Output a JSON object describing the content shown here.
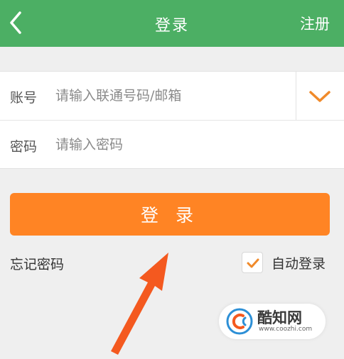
{
  "header": {
    "title": "登录",
    "register_label": "注册",
    "background": "#4caf64"
  },
  "form": {
    "account": {
      "label": "账号",
      "placeholder": "请输入联通号码/邮箱",
      "value": ""
    },
    "password": {
      "label": "密码",
      "placeholder": "请输入密码",
      "value": ""
    },
    "dropdown_icon": "chevron-down-icon"
  },
  "actions": {
    "login_label": "登 录",
    "login_color": "#ff8424",
    "forgot_label": "忘记密码",
    "auto_login_label": "自动登录",
    "auto_login_checked": true
  },
  "annotation": {
    "arrow_color": "#f4591f"
  },
  "watermark": {
    "name": "酷知网",
    "url": "www.coozhi.com"
  }
}
